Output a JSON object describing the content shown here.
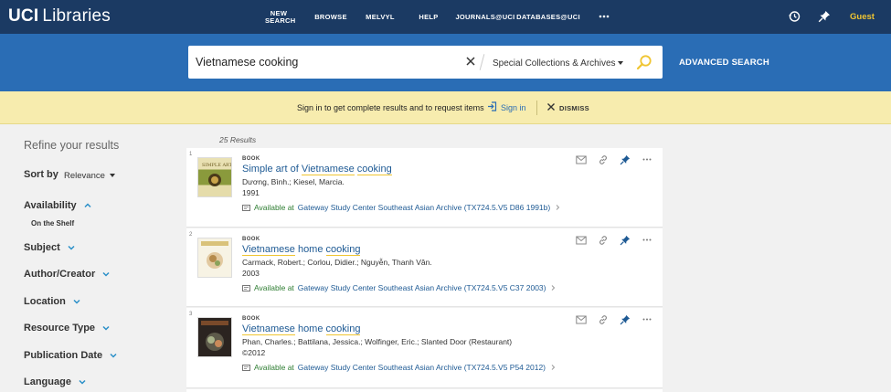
{
  "header": {
    "logo_bold": "UCI",
    "logo_rest": "Libraries",
    "nav": [
      {
        "label": "NEW SEARCH"
      },
      {
        "label": "BROWSE"
      },
      {
        "label": "MELVYL"
      },
      {
        "label": "HELP"
      },
      {
        "label": "JOURNALS@UCI"
      },
      {
        "label": "DATABASES@UCI"
      }
    ],
    "more_icon": "ellipsis-icon",
    "history_icon": "history-icon",
    "pin_icon": "pin-icon",
    "user_label": "Guest"
  },
  "search": {
    "query": "Vietnamese cooking",
    "scope": "Special Collections & Archives",
    "advanced_label": "ADVANCED SEARCH"
  },
  "banner": {
    "message": "Sign in to get complete results and to request items",
    "signin_label": "Sign in",
    "dismiss_label": "DISMISS"
  },
  "facets": {
    "title": "Refine your results",
    "sort_label": "Sort by",
    "sort_value": "Relevance",
    "groups": [
      {
        "label": "Availability",
        "expanded": true,
        "sub": "On the Shelf"
      },
      {
        "label": "Subject"
      },
      {
        "label": "Author/Creator"
      },
      {
        "label": "Location"
      },
      {
        "label": "Resource Type"
      },
      {
        "label": "Publication Date"
      },
      {
        "label": "Language"
      }
    ]
  },
  "results": {
    "count": "25 Results",
    "items": [
      {
        "num": "1",
        "type": "BOOK",
        "title_pre": "Simple art of ",
        "title_hl1": "Vietnamese",
        "title_mid": " ",
        "title_hl2": "cooking",
        "author": "Dương, Bình.; Kiesel, Marcia.",
        "date": "1991",
        "status": "Available at",
        "location": "Gateway Study Center Southeast Asian Archive (TX724.5.V5 D86 1991b)"
      },
      {
        "num": "2",
        "type": "BOOK",
        "title_pre": "",
        "title_hl1": "Vietnamese",
        "title_mid": " home ",
        "title_hl2": "cooking",
        "author": "Carmack, Robert.; Corlou, Didier.; Nguyễn, Thanh Vân.",
        "date": "2003",
        "status": "Available at",
        "location": "Gateway Study Center Southeast Asian Archive (TX724.5.V5 C37 2003)"
      },
      {
        "num": "3",
        "type": "BOOK",
        "title_pre": "",
        "title_hl1": "Vietnamese",
        "title_mid": " home ",
        "title_hl2": "cooking",
        "author": "Phan, Charles.; Battilana, Jessica.; Wolfinger, Eric.; Slanted Door (Restaurant)",
        "date": "©2012",
        "status": "Available at",
        "location": "Gateway Study Center Southeast Asian Archive (TX724.5.V5 P54 2012)"
      }
    ]
  },
  "colors": {
    "nav_bg": "#1b3a63",
    "search_bg": "#2a6db5",
    "banner_bg": "#f7ecae",
    "accent": "#f0c531",
    "link": "#1e5a94",
    "available": "#2e7d32"
  }
}
